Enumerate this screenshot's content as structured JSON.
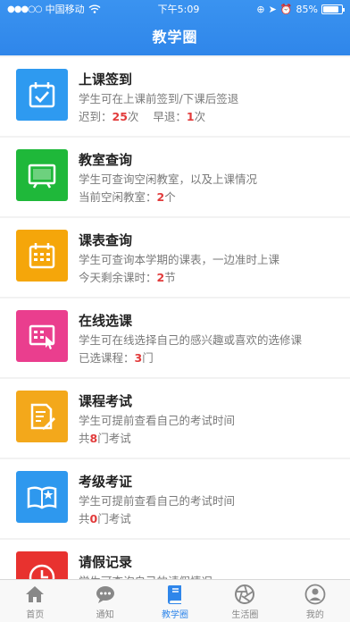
{
  "status_bar": {
    "carrier": "中国移动",
    "time": "下午5:09",
    "battery": "85%"
  },
  "nav": {
    "title": "教学圈"
  },
  "cards": [
    {
      "title": "上课签到",
      "desc": "学生可在上课前签到/下课后签退",
      "stat": {
        "a_label": "迟到：",
        "a_value": "25",
        "a_unit": "次",
        "b_label": "早退：",
        "b_value": "1",
        "b_unit": "次"
      },
      "icon": "calendar-check-icon",
      "color": "#2e9af0"
    },
    {
      "title": "教室查询",
      "desc": "学生可查询空闲教室，以及上课情况",
      "stat": {
        "prefix": "当前空闲教室：",
        "value": "2",
        "suffix": "个"
      },
      "icon": "blackboard-icon",
      "color": "#1fb83a"
    },
    {
      "title": "课表查询",
      "desc": "学生可查询本学期的课表，一边准时上课",
      "stat": {
        "prefix": "今天剩余课时：",
        "value": "2",
        "suffix": "节"
      },
      "icon": "calendar-grid-icon",
      "color": "#f5a60a"
    },
    {
      "title": "在线选课",
      "desc": "学生可在线选择自己的感兴趣或喜欢的选修课",
      "stat": {
        "prefix": "已选课程：",
        "value": "3",
        "suffix": "门"
      },
      "icon": "select-course-icon",
      "color": "#ea3e8e"
    },
    {
      "title": "课程考试",
      "desc": "学生可提前查看自己的考试时间",
      "stat": {
        "prefix": "共",
        "value": "8",
        "suffix": "门考试"
      },
      "icon": "exam-paper-icon",
      "color": "#f3a81b"
    },
    {
      "title": "考级考证",
      "desc": "学生可提前查看自己的考试时间",
      "stat": {
        "prefix": "共",
        "value": "0",
        "suffix": "门考试"
      },
      "icon": "certificate-book-icon",
      "color": "#2e98ee"
    },
    {
      "title": "请假记录",
      "desc": "学生可查询自己的请假情况",
      "icon": "clock-icon",
      "color": "#e8322f"
    }
  ],
  "tabs": [
    {
      "label": "首页",
      "icon": "home-icon"
    },
    {
      "label": "通知",
      "icon": "chat-bubble-icon"
    },
    {
      "label": "教学圈",
      "icon": "book-icon"
    },
    {
      "label": "生活圈",
      "icon": "aperture-icon"
    },
    {
      "label": "我的",
      "icon": "person-icon"
    }
  ],
  "colors": {
    "nav_bg": "#2f86ea",
    "tab_active": "#2f86ea",
    "highlight": "#e23b3b"
  }
}
